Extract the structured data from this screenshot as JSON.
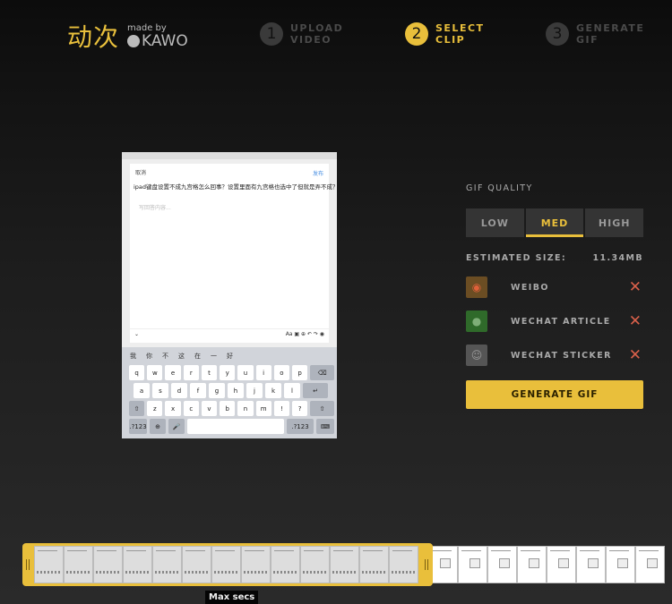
{
  "header": {
    "logo_cn": "动次",
    "made_by": "made by",
    "brand": "KAWO",
    "steps": [
      {
        "num": "1",
        "line1": "UPLOAD",
        "line2": "VIDEO",
        "active": false
      },
      {
        "num": "2",
        "line1": "SELECT",
        "line2": "CLIP",
        "active": true
      },
      {
        "num": "3",
        "line1": "GENERATE",
        "line2": "GIF",
        "active": false
      }
    ]
  },
  "video": {
    "cancel": "取消",
    "publish": "发布",
    "question": "ipad键盘设置不成九宫格怎么回事？设置里面有九宫格也选中了但就是弄不成？",
    "placeholder": "写回答内容...",
    "candidates": [
      "我",
      "你",
      "不",
      "这",
      "在",
      "一",
      "好"
    ],
    "rows": [
      [
        "q",
        "w",
        "e",
        "r",
        "t",
        "y",
        "u",
        "i",
        "o",
        "p"
      ],
      [
        "a",
        "s",
        "d",
        "f",
        "g",
        "h",
        "j",
        "k",
        "l"
      ],
      [
        "z",
        "x",
        "c",
        "v",
        "b",
        "n",
        "m",
        "!",
        "?"
      ]
    ],
    "key_123": ".?123"
  },
  "panel": {
    "quality_label": "GIF QUALITY",
    "quality_options": [
      "LOW",
      "MED",
      "HIGH"
    ],
    "selected_quality": "MED",
    "estimated_label": "ESTIMATED SIZE:",
    "estimated_value": "11.34MB",
    "platforms": [
      {
        "name": "WEIBO",
        "icon": "weibo-icon",
        "status": "x-icon"
      },
      {
        "name": "WECHAT ARTICLE",
        "icon": "wechat-icon",
        "status": "x-icon"
      },
      {
        "name": "WECHAT STICKER",
        "icon": "sticker-icon",
        "status": "x-icon"
      }
    ],
    "generate_label": "GENERATE GIF",
    "accent": "#e9bf3b",
    "error_color": "#d8604a"
  },
  "timeline": {
    "tooltip": "Max secs"
  }
}
